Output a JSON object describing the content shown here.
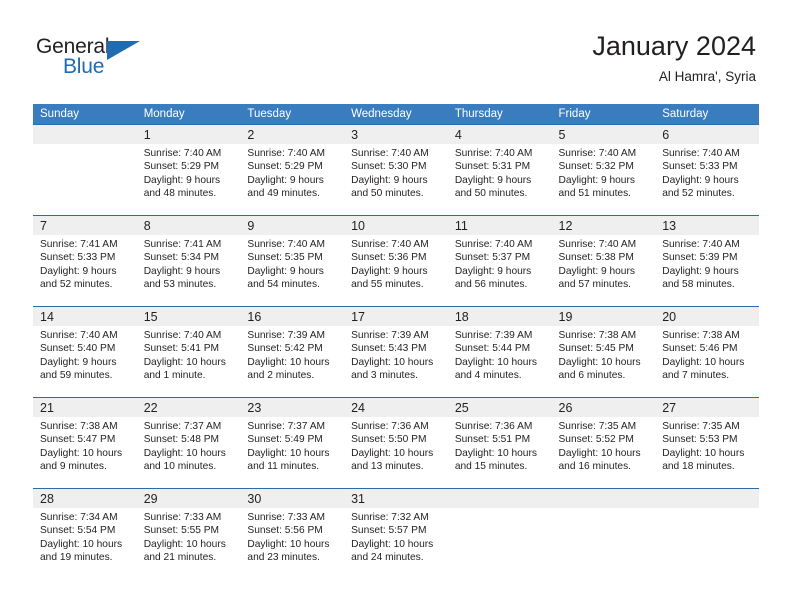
{
  "brand": {
    "name_part1": "General",
    "name_part2": "Blue",
    "color_black": "#231f20",
    "color_blue": "#1f6cb0"
  },
  "header": {
    "title": "January 2024",
    "subtitle": "Al Hamra', Syria"
  },
  "theme": {
    "header_row_bg": "#3a7dbf",
    "row_divider": "#2a6ca8",
    "daynum_band_bg": "#efefef",
    "text": "#231f20"
  },
  "weekdays": [
    "Sunday",
    "Monday",
    "Tuesday",
    "Wednesday",
    "Thursday",
    "Friday",
    "Saturday"
  ],
  "weeks": [
    [
      {
        "day": "",
        "sunrise": "",
        "sunset": "",
        "daylight": "",
        "daylight2": ""
      },
      {
        "day": "1",
        "sunrise": "Sunrise: 7:40 AM",
        "sunset": "Sunset: 5:29 PM",
        "daylight": "Daylight: 9 hours",
        "daylight2": "and 48 minutes."
      },
      {
        "day": "2",
        "sunrise": "Sunrise: 7:40 AM",
        "sunset": "Sunset: 5:29 PM",
        "daylight": "Daylight: 9 hours",
        "daylight2": "and 49 minutes."
      },
      {
        "day": "3",
        "sunrise": "Sunrise: 7:40 AM",
        "sunset": "Sunset: 5:30 PM",
        "daylight": "Daylight: 9 hours",
        "daylight2": "and 50 minutes."
      },
      {
        "day": "4",
        "sunrise": "Sunrise: 7:40 AM",
        "sunset": "Sunset: 5:31 PM",
        "daylight": "Daylight: 9 hours",
        "daylight2": "and 50 minutes."
      },
      {
        "day": "5",
        "sunrise": "Sunrise: 7:40 AM",
        "sunset": "Sunset: 5:32 PM",
        "daylight": "Daylight: 9 hours",
        "daylight2": "and 51 minutes."
      },
      {
        "day": "6",
        "sunrise": "Sunrise: 7:40 AM",
        "sunset": "Sunset: 5:33 PM",
        "daylight": "Daylight: 9 hours",
        "daylight2": "and 52 minutes."
      }
    ],
    [
      {
        "day": "7",
        "sunrise": "Sunrise: 7:41 AM",
        "sunset": "Sunset: 5:33 PM",
        "daylight": "Daylight: 9 hours",
        "daylight2": "and 52 minutes."
      },
      {
        "day": "8",
        "sunrise": "Sunrise: 7:41 AM",
        "sunset": "Sunset: 5:34 PM",
        "daylight": "Daylight: 9 hours",
        "daylight2": "and 53 minutes."
      },
      {
        "day": "9",
        "sunrise": "Sunrise: 7:40 AM",
        "sunset": "Sunset: 5:35 PM",
        "daylight": "Daylight: 9 hours",
        "daylight2": "and 54 minutes."
      },
      {
        "day": "10",
        "sunrise": "Sunrise: 7:40 AM",
        "sunset": "Sunset: 5:36 PM",
        "daylight": "Daylight: 9 hours",
        "daylight2": "and 55 minutes."
      },
      {
        "day": "11",
        "sunrise": "Sunrise: 7:40 AM",
        "sunset": "Sunset: 5:37 PM",
        "daylight": "Daylight: 9 hours",
        "daylight2": "and 56 minutes."
      },
      {
        "day": "12",
        "sunrise": "Sunrise: 7:40 AM",
        "sunset": "Sunset: 5:38 PM",
        "daylight": "Daylight: 9 hours",
        "daylight2": "and 57 minutes."
      },
      {
        "day": "13",
        "sunrise": "Sunrise: 7:40 AM",
        "sunset": "Sunset: 5:39 PM",
        "daylight": "Daylight: 9 hours",
        "daylight2": "and 58 minutes."
      }
    ],
    [
      {
        "day": "14",
        "sunrise": "Sunrise: 7:40 AM",
        "sunset": "Sunset: 5:40 PM",
        "daylight": "Daylight: 9 hours",
        "daylight2": "and 59 minutes."
      },
      {
        "day": "15",
        "sunrise": "Sunrise: 7:40 AM",
        "sunset": "Sunset: 5:41 PM",
        "daylight": "Daylight: 10 hours",
        "daylight2": "and 1 minute."
      },
      {
        "day": "16",
        "sunrise": "Sunrise: 7:39 AM",
        "sunset": "Sunset: 5:42 PM",
        "daylight": "Daylight: 10 hours",
        "daylight2": "and 2 minutes."
      },
      {
        "day": "17",
        "sunrise": "Sunrise: 7:39 AM",
        "sunset": "Sunset: 5:43 PM",
        "daylight": "Daylight: 10 hours",
        "daylight2": "and 3 minutes."
      },
      {
        "day": "18",
        "sunrise": "Sunrise: 7:39 AM",
        "sunset": "Sunset: 5:44 PM",
        "daylight": "Daylight: 10 hours",
        "daylight2": "and 4 minutes."
      },
      {
        "day": "19",
        "sunrise": "Sunrise: 7:38 AM",
        "sunset": "Sunset: 5:45 PM",
        "daylight": "Daylight: 10 hours",
        "daylight2": "and 6 minutes."
      },
      {
        "day": "20",
        "sunrise": "Sunrise: 7:38 AM",
        "sunset": "Sunset: 5:46 PM",
        "daylight": "Daylight: 10 hours",
        "daylight2": "and 7 minutes."
      }
    ],
    [
      {
        "day": "21",
        "sunrise": "Sunrise: 7:38 AM",
        "sunset": "Sunset: 5:47 PM",
        "daylight": "Daylight: 10 hours",
        "daylight2": "and 9 minutes."
      },
      {
        "day": "22",
        "sunrise": "Sunrise: 7:37 AM",
        "sunset": "Sunset: 5:48 PM",
        "daylight": "Daylight: 10 hours",
        "daylight2": "and 10 minutes."
      },
      {
        "day": "23",
        "sunrise": "Sunrise: 7:37 AM",
        "sunset": "Sunset: 5:49 PM",
        "daylight": "Daylight: 10 hours",
        "daylight2": "and 11 minutes."
      },
      {
        "day": "24",
        "sunrise": "Sunrise: 7:36 AM",
        "sunset": "Sunset: 5:50 PM",
        "daylight": "Daylight: 10 hours",
        "daylight2": "and 13 minutes."
      },
      {
        "day": "25",
        "sunrise": "Sunrise: 7:36 AM",
        "sunset": "Sunset: 5:51 PM",
        "daylight": "Daylight: 10 hours",
        "daylight2": "and 15 minutes."
      },
      {
        "day": "26",
        "sunrise": "Sunrise: 7:35 AM",
        "sunset": "Sunset: 5:52 PM",
        "daylight": "Daylight: 10 hours",
        "daylight2": "and 16 minutes."
      },
      {
        "day": "27",
        "sunrise": "Sunrise: 7:35 AM",
        "sunset": "Sunset: 5:53 PM",
        "daylight": "Daylight: 10 hours",
        "daylight2": "and 18 minutes."
      }
    ],
    [
      {
        "day": "28",
        "sunrise": "Sunrise: 7:34 AM",
        "sunset": "Sunset: 5:54 PM",
        "daylight": "Daylight: 10 hours",
        "daylight2": "and 19 minutes."
      },
      {
        "day": "29",
        "sunrise": "Sunrise: 7:33 AM",
        "sunset": "Sunset: 5:55 PM",
        "daylight": "Daylight: 10 hours",
        "daylight2": "and 21 minutes."
      },
      {
        "day": "30",
        "sunrise": "Sunrise: 7:33 AM",
        "sunset": "Sunset: 5:56 PM",
        "daylight": "Daylight: 10 hours",
        "daylight2": "and 23 minutes."
      },
      {
        "day": "31",
        "sunrise": "Sunrise: 7:32 AM",
        "sunset": "Sunset: 5:57 PM",
        "daylight": "Daylight: 10 hours",
        "daylight2": "and 24 minutes."
      },
      {
        "day": "",
        "sunrise": "",
        "sunset": "",
        "daylight": "",
        "daylight2": ""
      },
      {
        "day": "",
        "sunrise": "",
        "sunset": "",
        "daylight": "",
        "daylight2": ""
      },
      {
        "day": "",
        "sunrise": "",
        "sunset": "",
        "daylight": "",
        "daylight2": ""
      }
    ]
  ]
}
